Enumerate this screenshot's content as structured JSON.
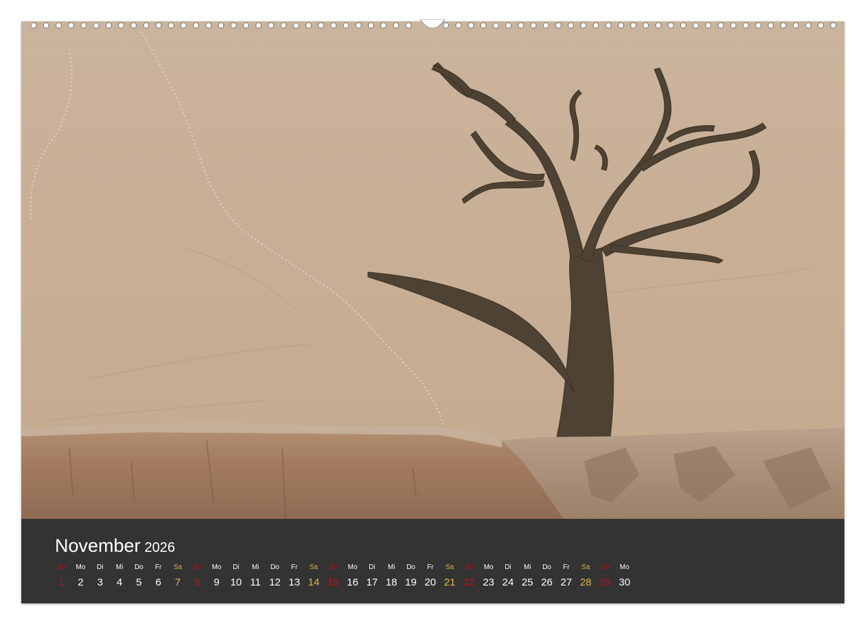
{
  "calendar": {
    "month": "November",
    "year": "2026",
    "days": [
      {
        "name": "So",
        "num": "1",
        "type": "sun"
      },
      {
        "name": "Mo",
        "num": "2",
        "type": "week"
      },
      {
        "name": "Di",
        "num": "3",
        "type": "week"
      },
      {
        "name": "Mi",
        "num": "4",
        "type": "week"
      },
      {
        "name": "Do",
        "num": "5",
        "type": "week"
      },
      {
        "name": "Fr",
        "num": "6",
        "type": "week"
      },
      {
        "name": "Sa",
        "num": "7",
        "type": "sat"
      },
      {
        "name": "So",
        "num": "8",
        "type": "sun"
      },
      {
        "name": "Mo",
        "num": "9",
        "type": "week"
      },
      {
        "name": "Di",
        "num": "10",
        "type": "week"
      },
      {
        "name": "Mi",
        "num": "11",
        "type": "week"
      },
      {
        "name": "Do",
        "num": "12",
        "type": "week"
      },
      {
        "name": "Fr",
        "num": "13",
        "type": "week"
      },
      {
        "name": "Sa",
        "num": "14",
        "type": "sat"
      },
      {
        "name": "So",
        "num": "15",
        "type": "sun"
      },
      {
        "name": "Mo",
        "num": "16",
        "type": "week"
      },
      {
        "name": "Di",
        "num": "17",
        "type": "week"
      },
      {
        "name": "Mi",
        "num": "18",
        "type": "week"
      },
      {
        "name": "Do",
        "num": "19",
        "type": "week"
      },
      {
        "name": "Fr",
        "num": "20",
        "type": "week"
      },
      {
        "name": "Sa",
        "num": "21",
        "type": "sat"
      },
      {
        "name": "So",
        "num": "22",
        "type": "sun"
      },
      {
        "name": "Mo",
        "num": "23",
        "type": "week"
      },
      {
        "name": "Di",
        "num": "24",
        "type": "week"
      },
      {
        "name": "Mi",
        "num": "25",
        "type": "week"
      },
      {
        "name": "Do",
        "num": "26",
        "type": "week"
      },
      {
        "name": "Fr",
        "num": "27",
        "type": "week"
      },
      {
        "name": "Sa",
        "num": "28",
        "type": "sat"
      },
      {
        "name": "So",
        "num": "29",
        "type": "sun"
      },
      {
        "name": "Mo",
        "num": "30",
        "type": "week"
      }
    ]
  },
  "colors": {
    "sunday": "#b3161b",
    "saturday": "#e4b54a",
    "weekday": "#ffffff",
    "calendar_background": "#333333",
    "sand": "#c9b299",
    "rock": "#a9836a",
    "tree": "#4a3f30"
  }
}
